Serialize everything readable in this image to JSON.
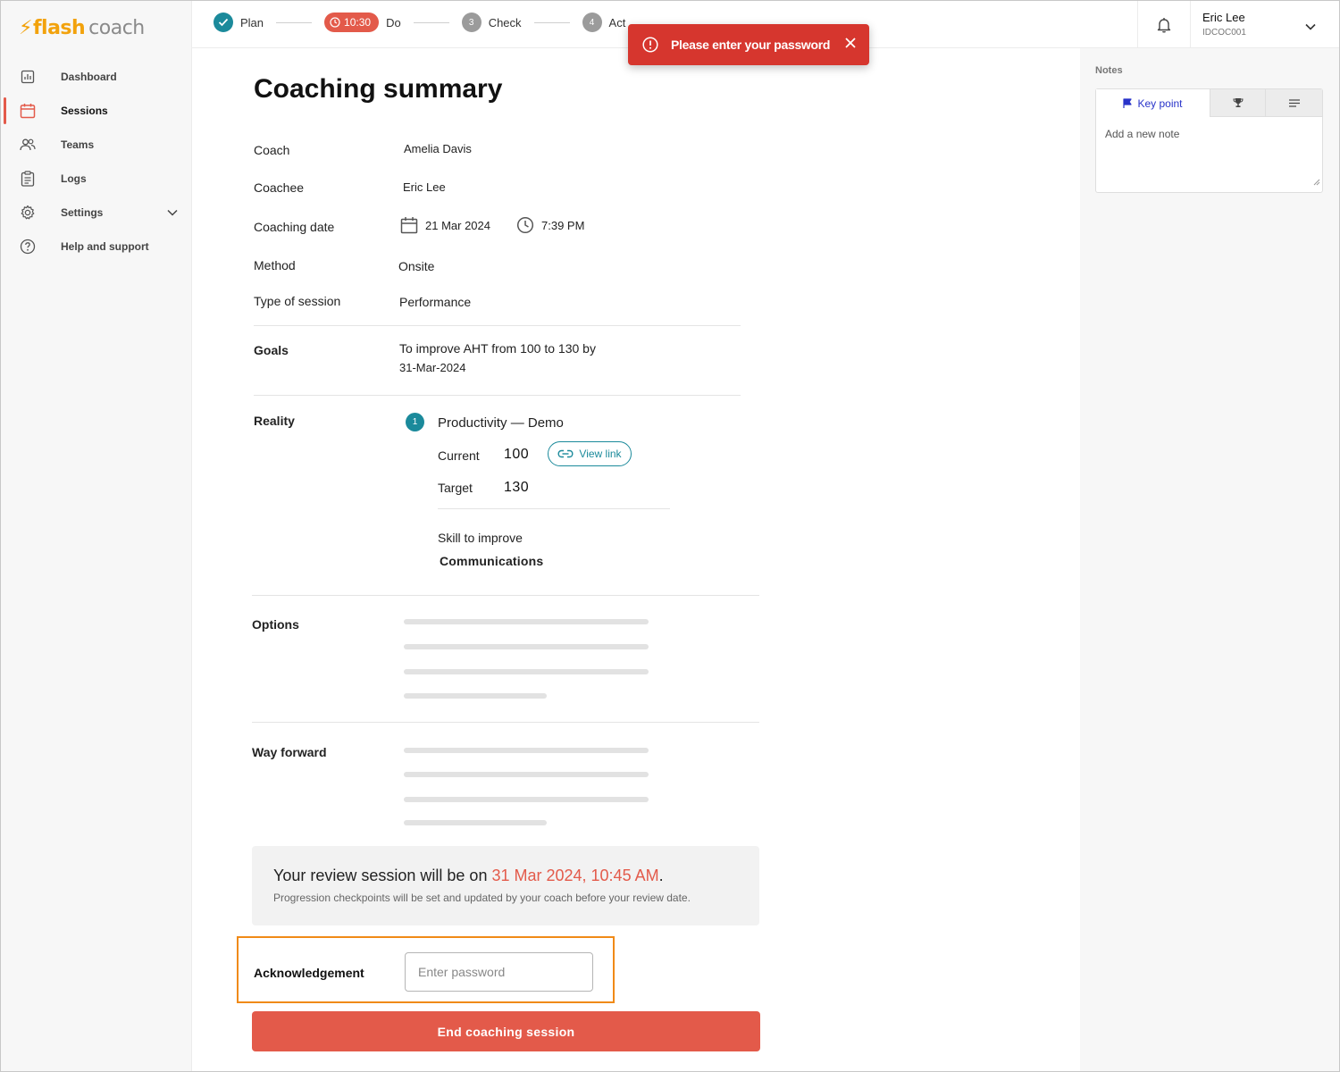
{
  "brand": {
    "flash": "flash",
    "coach": "coach"
  },
  "sidebar": {
    "items": [
      {
        "label": "Dashboard",
        "icon": "chart-icon"
      },
      {
        "label": "Sessions",
        "icon": "calendar-icon",
        "active": true
      },
      {
        "label": "Teams",
        "icon": "people-icon"
      },
      {
        "label": "Logs",
        "icon": "clipboard-icon"
      },
      {
        "label": "Settings",
        "icon": "gear-icon"
      },
      {
        "label": "Help and support",
        "icon": "help-icon"
      }
    ]
  },
  "steps": {
    "plan": "Plan",
    "timer": "10:30",
    "do": "Do",
    "check_num": "3",
    "check": "Check",
    "act_num": "4",
    "act": "Act"
  },
  "user": {
    "name": "Eric Lee",
    "id": "IDCOC001"
  },
  "toast": {
    "message": "Please enter your password"
  },
  "summary": {
    "title": "Coaching summary",
    "coach_label": "Coach",
    "coach_value": "Amelia Davis",
    "coachee_label": "Coachee",
    "coachee_value": "Eric Lee",
    "date_label": "Coaching date",
    "date_value": "21 Mar 2024",
    "time_value": "7:39 PM",
    "method_label": "Method",
    "method_value": "Onsite",
    "type_label": "Type of session",
    "type_value": "Performance",
    "goals_label": "Goals",
    "goals_line1": "To improve AHT from 100 to 130  by",
    "goals_line2": "31-Mar-2024",
    "reality_label": "Reality",
    "reality_num": "1",
    "reality_title": "Productivity — Demo",
    "current_label": "Current",
    "current_value": "100",
    "view_link": "View link",
    "target_label": "Target",
    "target_value": "130",
    "skill_label": "Skill to improve",
    "skill_value": "Communications",
    "options_label": "Options",
    "way_forward_label": "Way forward"
  },
  "review": {
    "prefix": "Your review session will be on ",
    "date": "31 Mar 2024, 10:45 AM",
    "suffix": ".",
    "note": "Progression checkpoints will be set and updated by your coach before your review date."
  },
  "ack": {
    "label": "Acknowledgement",
    "placeholder": "Enter password"
  },
  "end_button": "End coaching session",
  "notes": {
    "title": "Notes",
    "tab_key_point": "Key point",
    "placeholder": "Add a new note"
  },
  "colors": {
    "accent": "#e35a4a",
    "teal": "#1b8a9b",
    "toast": "#d6362e",
    "highlight": "#f08a17",
    "brand": "#f2a20c"
  }
}
